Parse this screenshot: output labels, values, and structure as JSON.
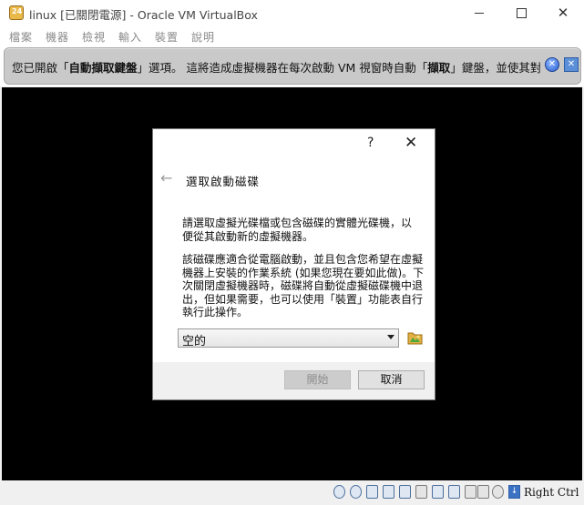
{
  "window": {
    "title": "linux [已關閉電源] - Oracle VM VirtualBox",
    "icon_text": "24"
  },
  "menu": [
    "檔案",
    "機器",
    "檢視",
    "輸入",
    "裝置",
    "說明"
  ],
  "notice": {
    "t1": "您已開啟「",
    "b1": "自動擷取鍵盤",
    "t2": "」選項。 這將造成虛擬機器在每次啟動 VM 視窗時自動「",
    "b2": "擷取",
    "t3": "」鍵盤，並使其對主"
  },
  "dialog": {
    "help": "?",
    "close": "✕",
    "back": "←",
    "title": "選取啟動磁碟",
    "p1": "請選取虛擬光碟檔或包含磁碟的實體光碟機，以便從其啟動新的虛擬機器。",
    "p2": "該磁碟應適合從電腦啟動，並且包含您希望在虛擬機器上安裝的作業系統 (如果您現在要如此做)。下次關閉虛擬機器時，磁碟將自動從虛擬磁碟機中退出，但如果需要，也可以使用「裝置」功能表自行執行此操作。",
    "select_value": "空的",
    "start_label": "開始",
    "cancel_label": "取消"
  },
  "status": {
    "host_key": "Right Ctrl",
    "icons": [
      "hard-disk-icon",
      "optical-disk-icon",
      "audio-icon",
      "network-icon",
      "usb-icon",
      "shared-folders-icon",
      "display-icon",
      "video-capture-icon",
      "recording-icon",
      "cpu-icon",
      "mouse-integration-icon",
      "keyboard-icon"
    ]
  },
  "colors": {
    "notice_bg": "#c9c9c9",
    "vm_screen": "#000000",
    "dialog_footer": "#f0f0f0"
  }
}
